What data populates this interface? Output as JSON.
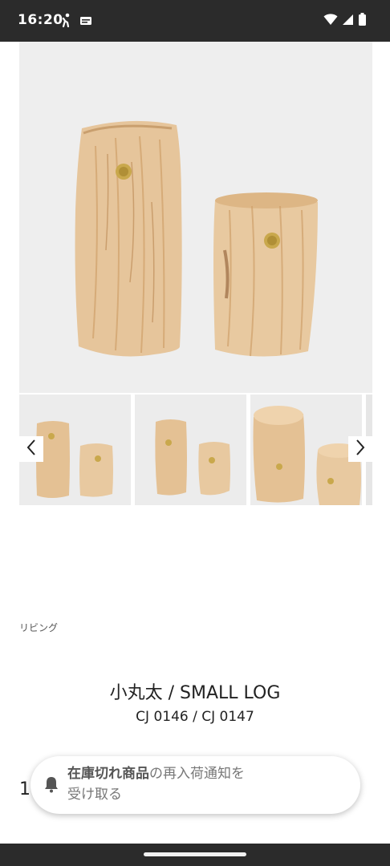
{
  "status_bar": {
    "time": "16:20",
    "left_icons": [
      "activity-icon",
      "message-icon"
    ],
    "right_icons": [
      "wifi-icon",
      "signal-icon",
      "battery-icon"
    ]
  },
  "gallery": {
    "main_image": "two-wooden-log-stools",
    "thumbnails": [
      "log-stools-front",
      "log-stools-angle",
      "log-stools-top",
      "log-stools-partial"
    ],
    "prev_icon": "chevron-left-icon",
    "next_icon": "chevron-right-icon"
  },
  "product": {
    "category": "リビング",
    "title": "小丸太 / SMALL LOG",
    "code": "CJ 0146 / CJ 0147",
    "quantity": "1"
  },
  "notify": {
    "icon": "bell-icon",
    "bold": "在庫切れ商品",
    "line1_rest": "の再入荷通知を",
    "line2": "受け取る"
  },
  "colors": {
    "bar": "#2b2b2b",
    "wood": "#e8c9a0",
    "brass": "#c9a84c",
    "image_bg": "#eeeeee"
  }
}
